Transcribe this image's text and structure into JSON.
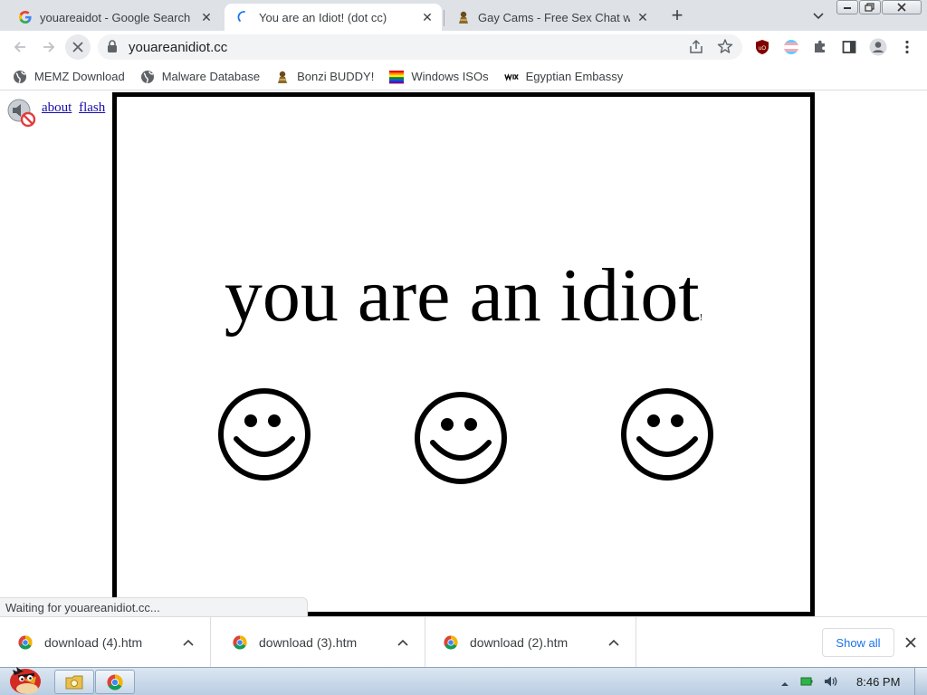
{
  "tabs": [
    {
      "title": "youareaidot - Google Search",
      "icon": "google-icon"
    },
    {
      "title": "You are an Idiot! (dot cc)",
      "icon": "loading-spinner-icon",
      "active": true
    },
    {
      "title": "Gay Cams - Free Sex Chat with",
      "icon": "bonzi-icon"
    }
  ],
  "omnibox": {
    "url": "youareanidiot.cc"
  },
  "bookmarks": [
    {
      "label": "MEMZ Download",
      "icon": "globe-icon"
    },
    {
      "label": "Malware Database",
      "icon": "globe-icon"
    },
    {
      "label": "Bonzi BUDDY!",
      "icon": "bonzi-icon"
    },
    {
      "label": "Windows ISOs",
      "icon": "rainbow-flag-icon"
    },
    {
      "label": "Egyptian Embassy",
      "icon": "wix-icon"
    }
  ],
  "page": {
    "links": {
      "about": "about",
      "flash": "flash"
    },
    "headline": "you are an idiot",
    "headline_punct": "!",
    "smileys": [
      "☺",
      "☺",
      "☺"
    ]
  },
  "status": "Waiting for youareanidiot.cc...",
  "downloads": [
    {
      "name": "download (4).htm"
    },
    {
      "name": "download (3).htm"
    },
    {
      "name": "download (2).htm"
    }
  ],
  "shelf": {
    "show_all": "Show all"
  },
  "taskbar": {
    "clock": "8:46 PM"
  },
  "colors": {
    "tabstrip_bg": "#dee1e6",
    "link": "#1a0dab",
    "accent": "#1a73e8",
    "frame_border": "#000000"
  }
}
